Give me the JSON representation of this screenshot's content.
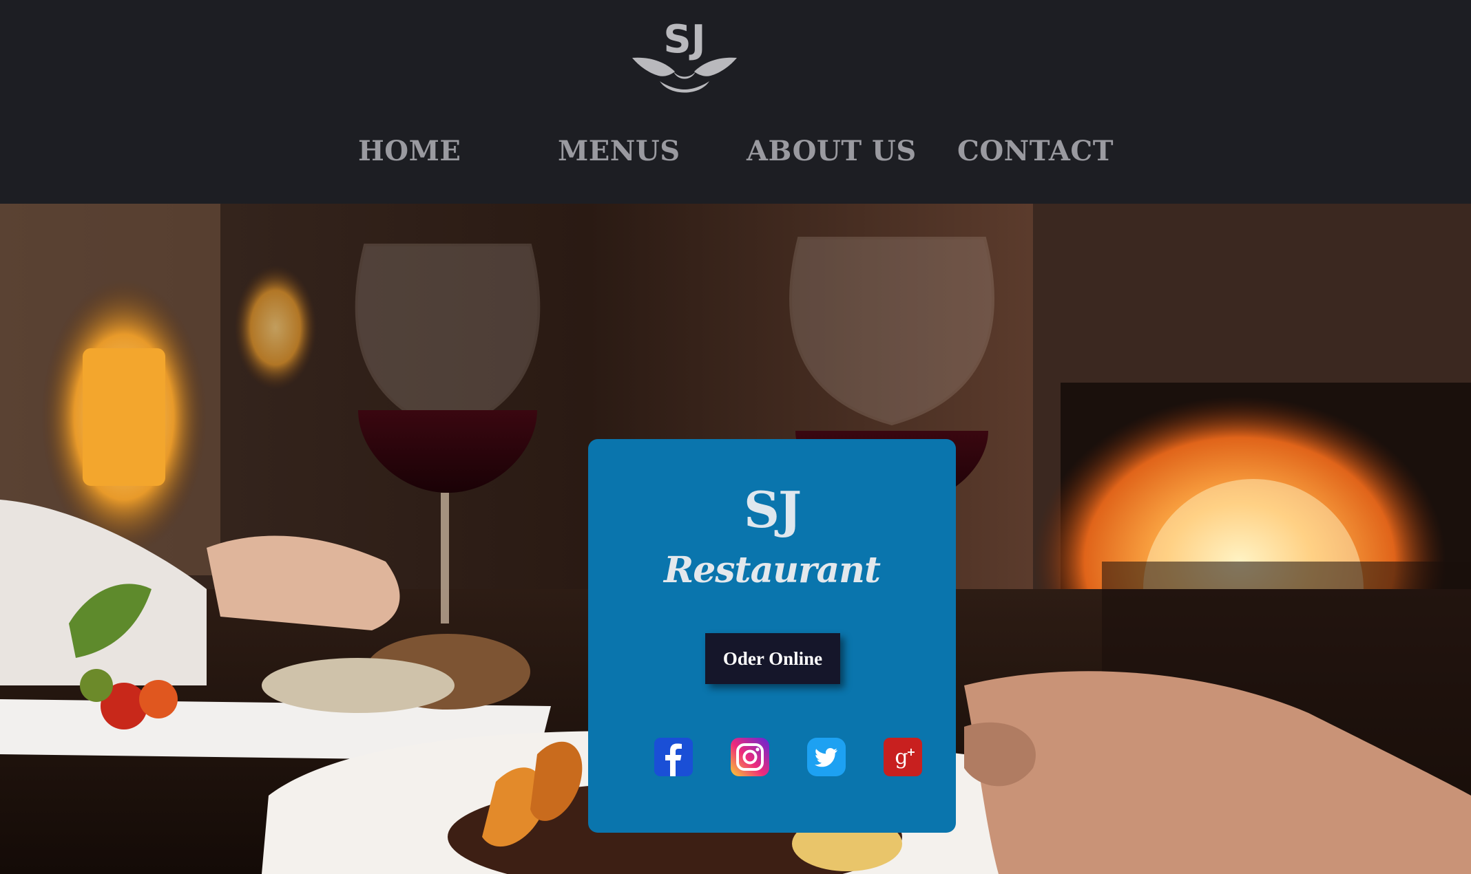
{
  "header": {
    "logo_text": "SJ",
    "nav": [
      {
        "label": "HOME"
      },
      {
        "label": "MENUS"
      },
      {
        "label": "ABOUT US"
      },
      {
        "label": "CONTACT"
      }
    ]
  },
  "hero": {
    "card": {
      "mark": "SJ",
      "title": "Restaurant",
      "order_button_label": "Oder Online",
      "social": [
        {
          "icon": "facebook-icon",
          "color": "#1a4fd6"
        },
        {
          "icon": "instagram-icon",
          "color": "#c13584"
        },
        {
          "icon": "twitter-icon",
          "color": "#1da1f2"
        },
        {
          "icon": "google-plus-icon",
          "color": "#c8201f"
        }
      ]
    }
  },
  "colors": {
    "header_bg": "#1d1e23",
    "nav_text": "#9a9aa0",
    "card_bg": "#0a75ad",
    "button_bg": "#15162a"
  }
}
